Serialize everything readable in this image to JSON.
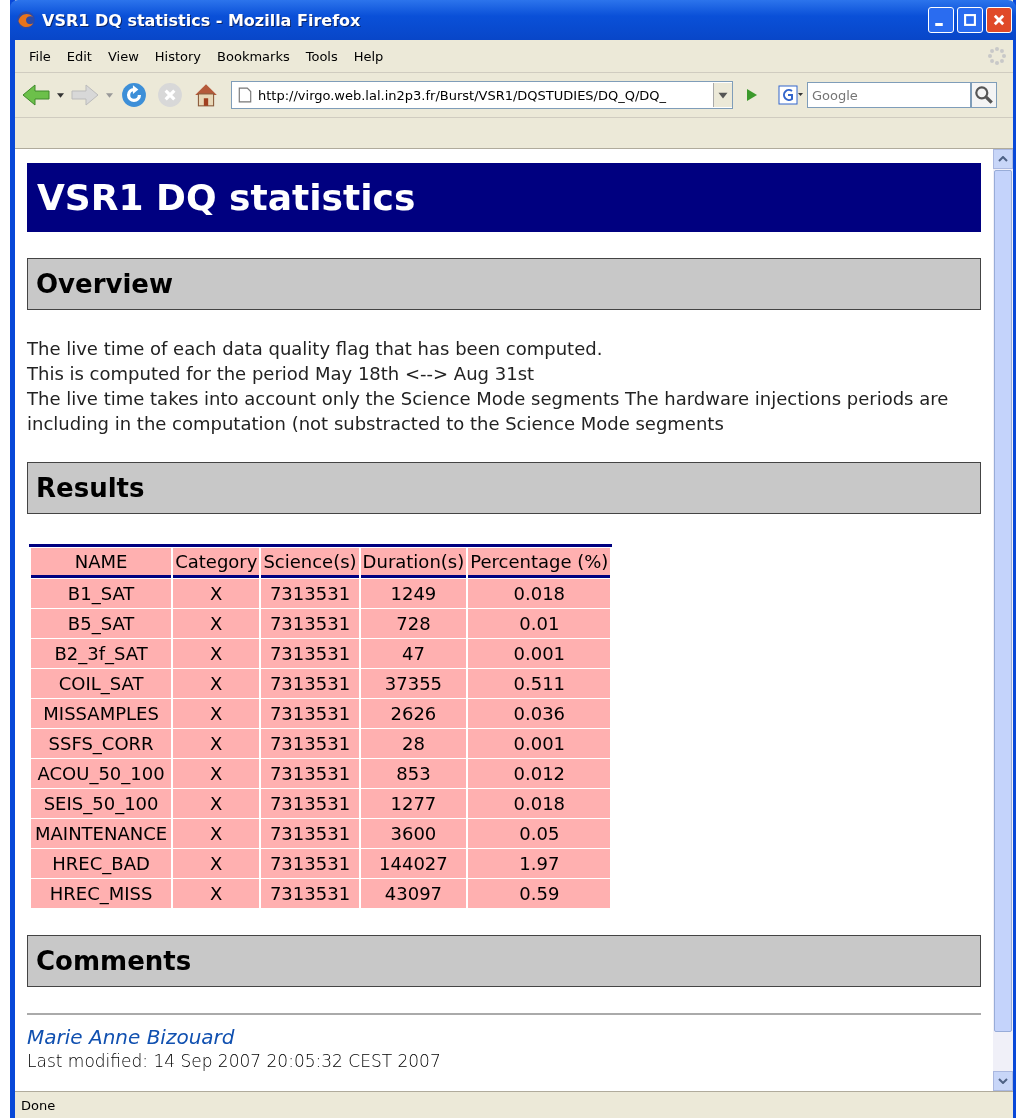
{
  "window": {
    "title": "VSR1 DQ statistics - Mozilla Firefox"
  },
  "menu": [
    "File",
    "Edit",
    "View",
    "History",
    "Bookmarks",
    "Tools",
    "Help"
  ],
  "toolbar": {
    "url": "http://virgo.web.lal.in2p3.fr/Burst/VSR1/DQSTUDIES/DQ_Q/DQ_",
    "search": {
      "placeholder": "Google"
    }
  },
  "page": {
    "title": "VSR1 DQ statistics",
    "overview": {
      "heading": "Overview",
      "lines": [
        "The live time of each data quality flag that has been computed.",
        "This is computed for the period May 18th <--> Aug 31st",
        "The live time takes into account only the Science Mode segments The hardware injections periods are including in the computation (not substracted to the Science Mode segments"
      ]
    },
    "results": {
      "heading": "Results",
      "table": {
        "columns": [
          "NAME",
          "Category",
          "Science(s)",
          "Duration(s)",
          "Percentage (%)"
        ],
        "rows": [
          [
            "B1_SAT",
            "X",
            "7313531",
            "1249",
            "0.018"
          ],
          [
            "B5_SAT",
            "X",
            "7313531",
            "728",
            "0.01"
          ],
          [
            "B2_3f_SAT",
            "X",
            "7313531",
            "47",
            "0.001"
          ],
          [
            "COIL_SAT",
            "X",
            "7313531",
            "37355",
            "0.511"
          ],
          [
            "MISSAMPLES",
            "X",
            "7313531",
            "2626",
            "0.036"
          ],
          [
            "SSFS_CORR",
            "X",
            "7313531",
            "28",
            "0.001"
          ],
          [
            "ACOU_50_100",
            "X",
            "7313531",
            "853",
            "0.012"
          ],
          [
            "SEIS_50_100",
            "X",
            "7313531",
            "1277",
            "0.018"
          ],
          [
            "MAINTENANCE",
            "X",
            "7313531",
            "3600",
            "0.05"
          ],
          [
            "HREC_BAD",
            "X",
            "7313531",
            "144027",
            "1.97"
          ],
          [
            "HREC_MISS",
            "X",
            "7313531",
            "43097",
            "0.59"
          ]
        ]
      }
    },
    "comments": {
      "heading": "Comments"
    },
    "author": "Marie Anne Bizouard",
    "last_modified": "Last modified: 14 Sep 2007 20:05:32 CEST 2007"
  },
  "status_bar": "Done"
}
